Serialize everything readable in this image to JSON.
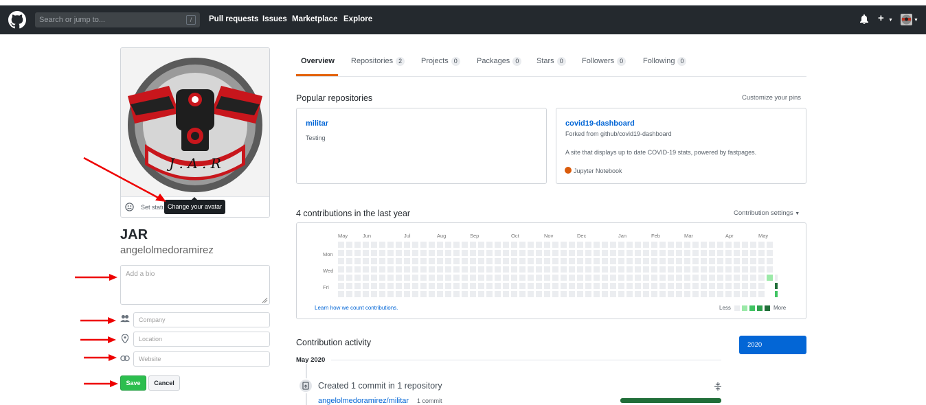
{
  "header": {
    "search_placeholder": "Search or jump to...",
    "slash_key": "/",
    "nav": [
      "Pull requests",
      "Issues",
      "Marketplace",
      "Explore"
    ]
  },
  "profile": {
    "set_status": "Set status",
    "tooltip": "Change your avatar",
    "name": "JAR",
    "login": "angelolmedoramirez",
    "bio_placeholder": "Add a bio",
    "company_placeholder": "Company",
    "location_placeholder": "Location",
    "website_placeholder": "Website",
    "save_label": "Save",
    "cancel_label": "Cancel",
    "avatar_text": "J . A . R"
  },
  "tabs": [
    {
      "label": "Overview",
      "count": ""
    },
    {
      "label": "Repositories",
      "count": "2"
    },
    {
      "label": "Projects",
      "count": "0"
    },
    {
      "label": "Packages",
      "count": "0"
    },
    {
      "label": "Stars",
      "count": "0"
    },
    {
      "label": "Followers",
      "count": "0"
    },
    {
      "label": "Following",
      "count": "0"
    }
  ],
  "popular": {
    "title": "Popular repositories",
    "customize": "Customize your pins",
    "repos": [
      {
        "name": "militar",
        "fork": "",
        "desc": "Testing",
        "lang": ""
      },
      {
        "name": "covid19-dashboard",
        "fork": "Forked from github/covid19-dashboard",
        "desc": "A site that displays up to date COVID-19 stats, powered by fastpages.",
        "lang": "Jupyter Notebook"
      }
    ]
  },
  "contributions": {
    "title": "4 contributions in the last year",
    "settings": "Contribution settings",
    "months": [
      "May",
      "Jun",
      "Jul",
      "Aug",
      "Sep",
      "Oct",
      "Nov",
      "Dec",
      "Jan",
      "Feb",
      "Mar",
      "Apr",
      "May"
    ],
    "days": [
      "Mon",
      "Wed",
      "Fri"
    ],
    "learn": "Learn how we count contributions.",
    "less": "Less",
    "more": "More",
    "colors": [
      "#ebedf0",
      "#9be9a8",
      "#40c463",
      "#30a14e",
      "#216e39"
    ]
  },
  "activity": {
    "title": "Contribution activity",
    "year": "2020",
    "month": "May 2020",
    "event": "Created 1 commit in 1 repository",
    "repo": "angelolmedoramirez/militar",
    "commits": "1 commit"
  }
}
